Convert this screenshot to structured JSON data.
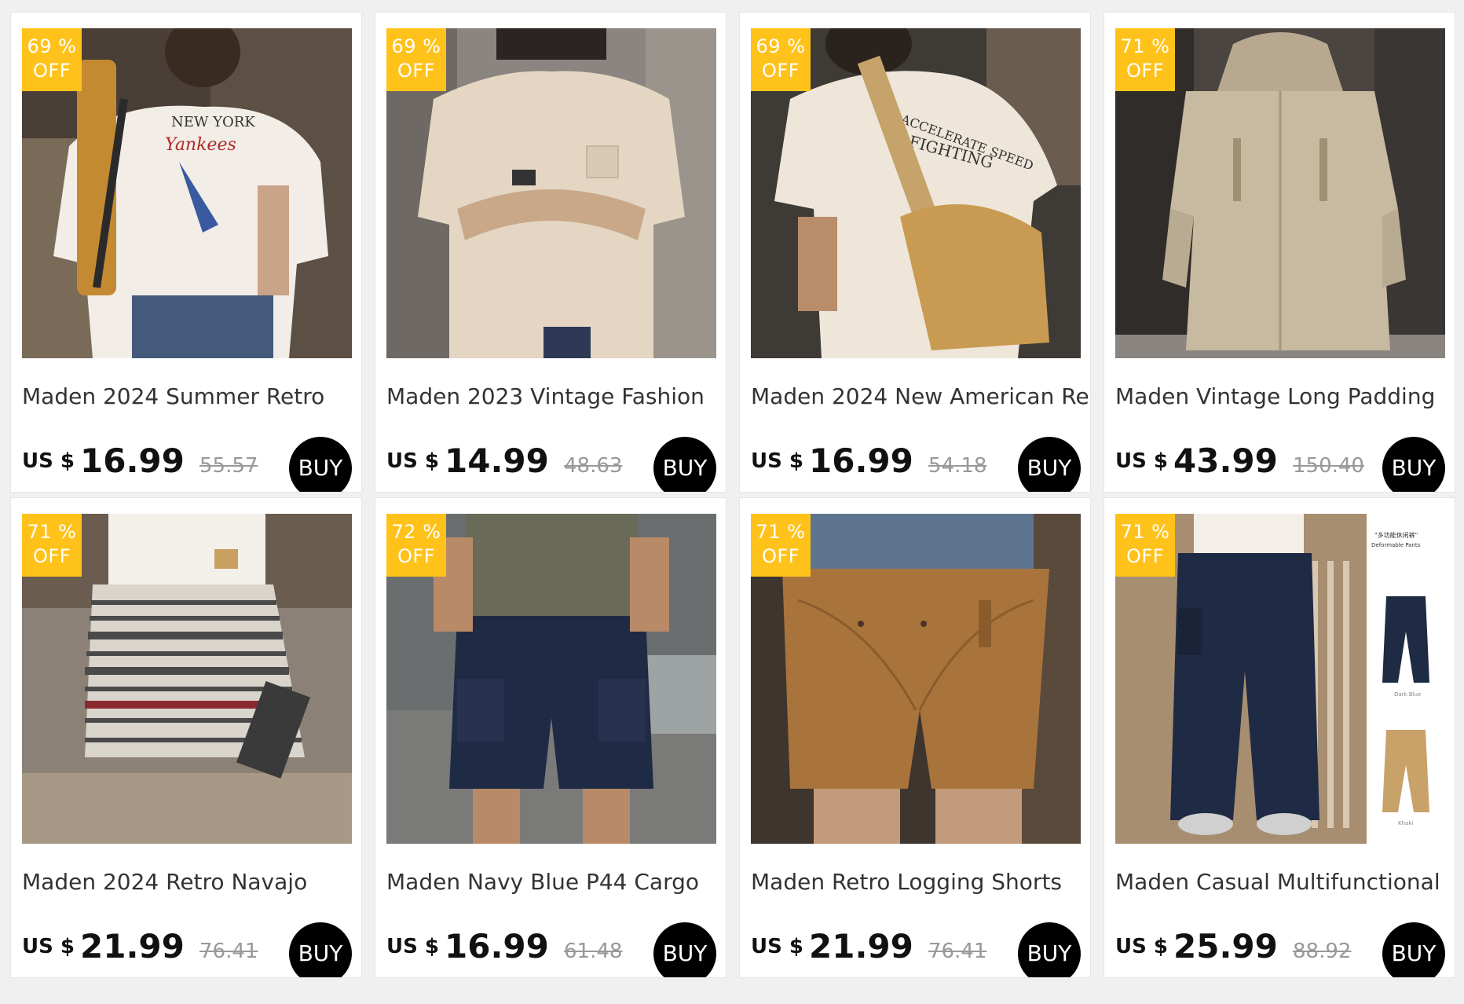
{
  "products": [
    {
      "discount_pct": "69 %",
      "discount_off": "OFF",
      "title": "Maden 2024 Summer Retro",
      "currency": "US $",
      "price": "16.99",
      "original_price": "55.57",
      "buy_label": "BUY",
      "image": "white-graphic-tee-photo"
    },
    {
      "discount_pct": "69 %",
      "discount_off": "OFF",
      "title": "Maden 2023 Vintage Fashion",
      "currency": "US $",
      "price": "14.99",
      "original_price": "48.63",
      "buy_label": "BUY",
      "image": "beige-pocket-tee-photo"
    },
    {
      "discount_pct": "69 %",
      "discount_off": "OFF",
      "title": "Maden 2024 New American Retro",
      "currency": "US $",
      "price": "16.99",
      "original_price": "54.18",
      "buy_label": "BUY",
      "image": "back-print-tee-with-bag-photo"
    },
    {
      "discount_pct": "71 %",
      "discount_off": "OFF",
      "title": "Maden Vintage Long Padding",
      "currency": "US $",
      "price": "43.99",
      "original_price": "150.40",
      "buy_label": "BUY",
      "image": "long-padded-coat-photo"
    },
    {
      "discount_pct": "71 %",
      "discount_off": "OFF",
      "title": "Maden 2024 Retro Navajo",
      "currency": "US $",
      "price": "21.99",
      "original_price": "76.41",
      "buy_label": "BUY",
      "image": "striped-navajo-shorts-photo"
    },
    {
      "discount_pct": "72 %",
      "discount_off": "OFF",
      "title": "Maden Navy Blue P44 Cargo",
      "currency": "US $",
      "price": "16.99",
      "original_price": "61.48",
      "buy_label": "BUY",
      "image": "navy-cargo-shorts-photo"
    },
    {
      "discount_pct": "71 %",
      "discount_off": "OFF",
      "title": "Maden Retro Logging Shorts",
      "currency": "US $",
      "price": "21.99",
      "original_price": "76.41",
      "buy_label": "BUY",
      "image": "brown-logging-shorts-photo"
    },
    {
      "discount_pct": "71 %",
      "discount_off": "OFF",
      "title": "Maden Casual Multifunctional",
      "currency": "US $",
      "price": "25.99",
      "original_price": "88.92",
      "buy_label": "BUY",
      "image": "navy-multifunction-pants-photo"
    }
  ],
  "colors": {
    "badge": "#ffc21a",
    "buy_button": "#000000",
    "page_bg": "#f0f0f0"
  }
}
